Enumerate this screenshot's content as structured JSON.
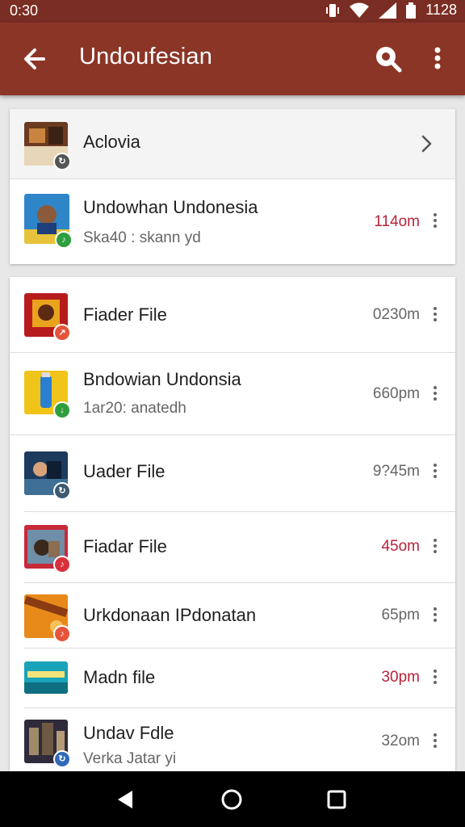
{
  "status_bar": {
    "time": "0:30",
    "right_time": "1128"
  },
  "app_bar": {
    "title": "Undoufesian"
  },
  "folder_row": {
    "label": "Aclovia"
  },
  "card1_items": [
    {
      "name": "Undowhan Undonesia",
      "sub": "Ska40 : skann yd",
      "time": "114om"
    }
  ],
  "card2_items": [
    {
      "name": "Fiader File",
      "sub": "",
      "time": "0230m"
    },
    {
      "name": "Bndowian Undonsia",
      "sub": "1ar20: anatedh",
      "time": "660pm"
    },
    {
      "name": "Uader File",
      "sub": "",
      "time": "9?45m"
    },
    {
      "name": "Fiadar File",
      "sub": "",
      "time": "45om"
    },
    {
      "name": "Urkdonaan IPdonatan",
      "sub": "",
      "time": "65pm"
    },
    {
      "name": "Madn file",
      "sub": "",
      "time": "30pm"
    },
    {
      "name": "Undav Fdle",
      "sub": "Verka Jatar yi",
      "time": "32om"
    }
  ],
  "colors": {
    "app_bar": "#8b3527",
    "status_bar": "#7a2d22",
    "accent_time": "#b8223a"
  }
}
